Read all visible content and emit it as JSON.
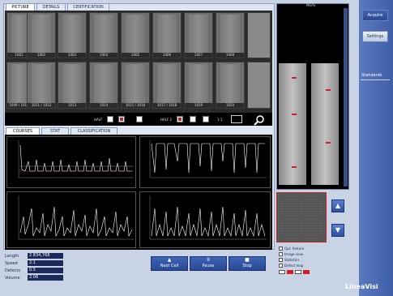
{
  "tabs_top": [
    "PICTURE",
    "DETAILS",
    "CERTIFICATION"
  ],
  "scroll_title": "MEAS",
  "thumbs_row1": [
    "1001",
    "1002",
    "1003",
    "1004",
    "1005",
    "1006",
    "1007",
    "1008"
  ],
  "thumbs_row2": [
    "1009 / 1010",
    "1011 / 1012",
    "1013",
    "1014",
    "1015 / 1016",
    "1017 / 1018",
    "1019",
    "1020"
  ],
  "toolbar": {
    "left_label": "HALF",
    "mid_label": "HALF 2",
    "zoom_label": "1:1"
  },
  "tabs_mid": [
    "COURSES",
    "STAT",
    "CLASSIFICATION"
  ],
  "stats": [
    {
      "label": "Length",
      "value": "2 834,768"
    },
    {
      "label": "Speed",
      "value": "2.1"
    },
    {
      "label": "Defects",
      "value": "0.5"
    },
    {
      "label": "Volume",
      "value": "2.06"
    }
  ],
  "controls": [
    {
      "label": "Next Cell",
      "icon": "▲"
    },
    {
      "label": "Pause",
      "icon": "II"
    },
    {
      "label": "Stop",
      "icon": "■"
    }
  ],
  "side_buttons": [
    "Acquire",
    "Settings"
  ],
  "side_section_label": "Standards",
  "options": [
    "Opt. feature",
    "Image view",
    "Statistics",
    "Defect map"
  ],
  "brand": "LineaVisi",
  "colors": {
    "bg": "#c9d3e6",
    "accent": "#2a4a92",
    "plot": "#000000",
    "trace": "#ffffff",
    "marker": "#d02020"
  }
}
